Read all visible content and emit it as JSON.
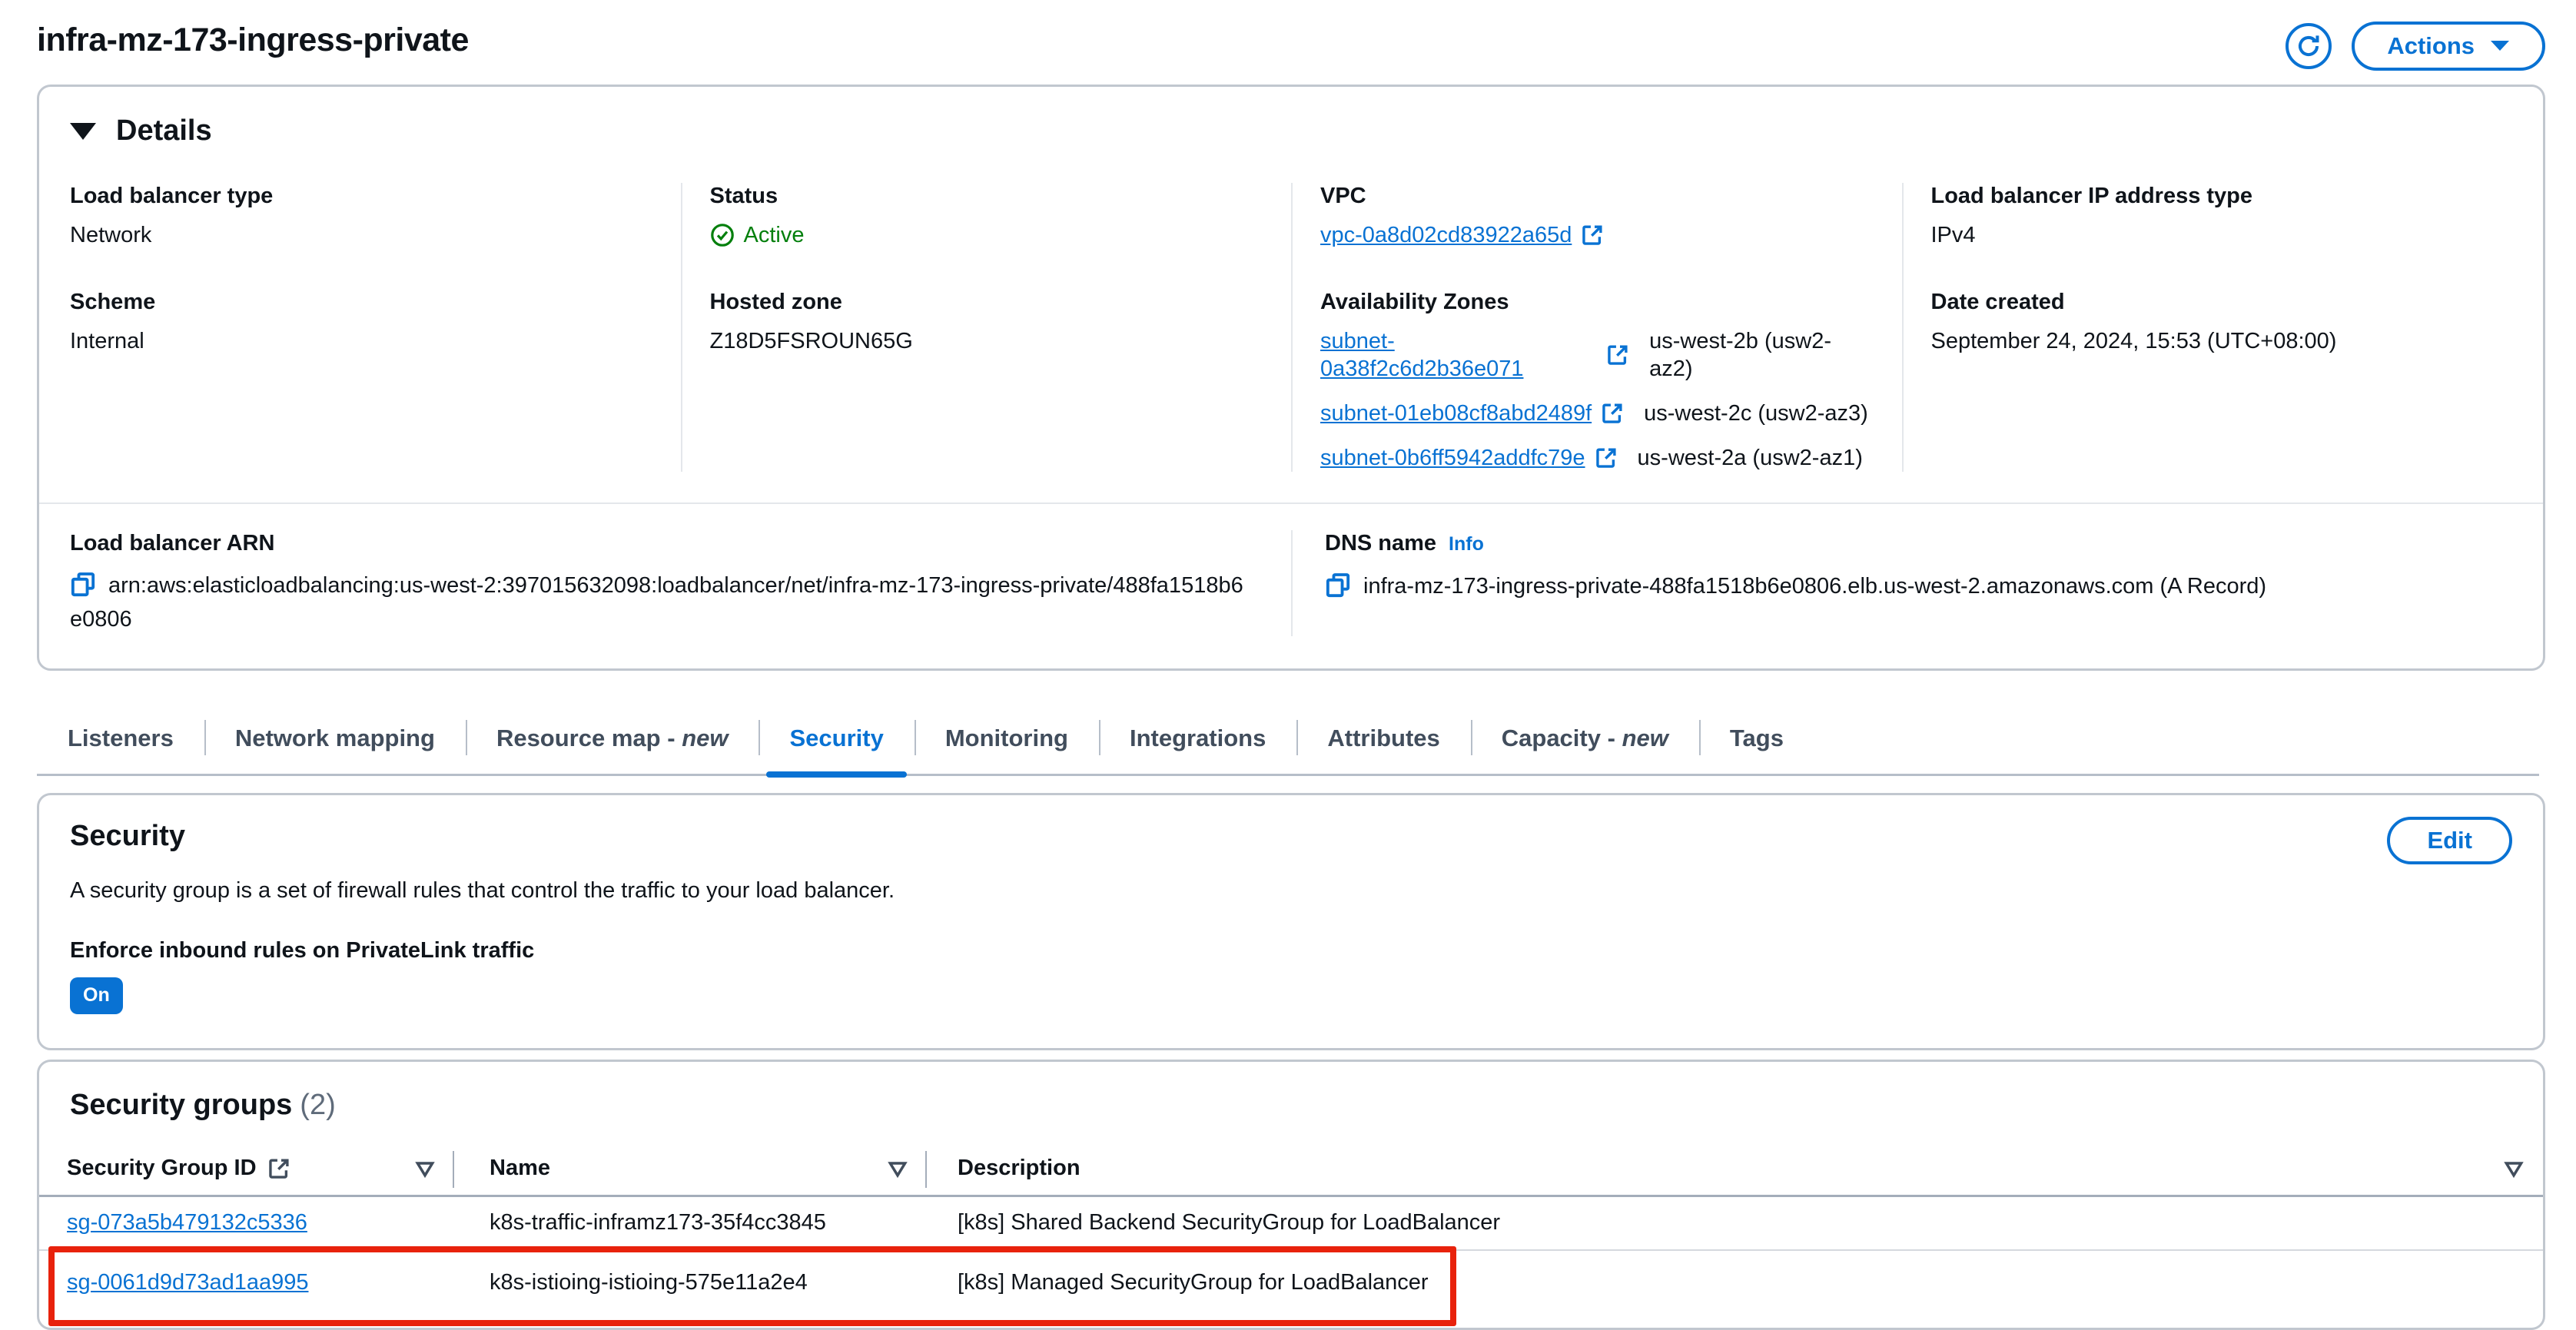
{
  "page_title": "infra-mz-173-ingress-private",
  "toolbar": {
    "actions_label": "Actions"
  },
  "details": {
    "heading": "Details",
    "load_balancer_type": {
      "label": "Load balancer type",
      "value": "Network"
    },
    "scheme": {
      "label": "Scheme",
      "value": "Internal"
    },
    "status": {
      "label": "Status",
      "value": "Active"
    },
    "hosted_zone": {
      "label": "Hosted zone",
      "value": "Z18D5FSROUN65G"
    },
    "vpc": {
      "label": "VPC",
      "value": "vpc-0a8d02cd83922a65d"
    },
    "availability_zones": {
      "label": "Availability Zones",
      "items": [
        {
          "subnet": "subnet-0a38f2c6d2b36e071",
          "zone": "us-west-2b (usw2-az2)"
        },
        {
          "subnet": "subnet-01eb08cf8abd2489f",
          "zone": "us-west-2c (usw2-az3)"
        },
        {
          "subnet": "subnet-0b6ff5942addfc79e",
          "zone": "us-west-2a (usw2-az1)"
        }
      ]
    },
    "ip_address_type": {
      "label": "Load balancer IP address type",
      "value": "IPv4"
    },
    "date_created": {
      "label": "Date created",
      "value": "September 24, 2024, 15:53 (UTC+08:00)"
    },
    "arn": {
      "label": "Load balancer ARN",
      "value": "arn:aws:elasticloadbalancing:us-west-2:397015632098:loadbalancer/net/infra-mz-173-ingress-private/488fa1518b6e0806"
    },
    "dns": {
      "label": "DNS name",
      "info_label": "Info",
      "value": "infra-mz-173-ingress-private-488fa1518b6e0806.elb.us-west-2.amazonaws.com (A Record)"
    }
  },
  "tabs": {
    "items": [
      {
        "label": "Listeners"
      },
      {
        "label": "Network mapping"
      },
      {
        "label": "Resource map -",
        "suffix": "new"
      },
      {
        "label": "Security"
      },
      {
        "label": "Monitoring"
      },
      {
        "label": "Integrations"
      },
      {
        "label": "Attributes"
      },
      {
        "label": "Capacity -",
        "suffix": "new"
      },
      {
        "label": "Tags"
      }
    ]
  },
  "security": {
    "heading": "Security",
    "edit_label": "Edit",
    "description": "A security group is a set of firewall rules that control the traffic to your load balancer.",
    "privatelink_label": "Enforce inbound rules on PrivateLink traffic",
    "privatelink_value": "On"
  },
  "security_groups": {
    "heading": "Security groups",
    "count": "(2)",
    "columns": [
      {
        "label": "Security Group ID"
      },
      {
        "label": "Name"
      },
      {
        "label": "Description"
      }
    ],
    "rows": [
      {
        "id": "sg-073a5b479132c5336",
        "name": "k8s-traffic-inframz173-35f4cc3845",
        "description": "[k8s] Shared Backend SecurityGroup for LoadBalancer"
      },
      {
        "id": "sg-0061d9d73ad1aa995",
        "name": "k8s-istioing-istioing-575e11a2e4",
        "description": "[k8s] Managed SecurityGroup for LoadBalancer"
      }
    ]
  },
  "colors": {
    "accent": "#0972d3",
    "success": "#037f0c",
    "annotation": "#e8220c"
  }
}
